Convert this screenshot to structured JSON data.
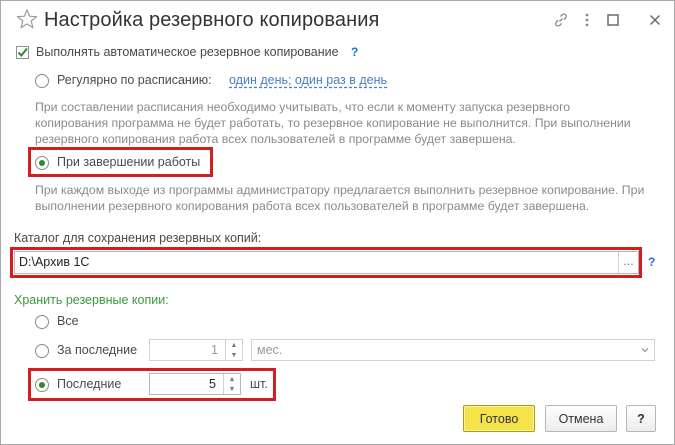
{
  "window": {
    "title": "Настройка резервного копирования"
  },
  "auto_backup": {
    "label": "Выполнять автоматическое резервное копирование",
    "checked": true,
    "help": "?"
  },
  "schedule": {
    "regular_label": "Регулярно по расписанию:",
    "regular_link": "один день; один раз в день",
    "regular_note": "При составлении расписания необходимо учитывать, что если к моменту запуска резервного копирования программа не будет работать, то резервное копирование не выполнится. При выполнении резервного копирования работа всех пользователей в программе будет завершена.",
    "on_exit_label": "При завершении работы",
    "on_exit_note": "При каждом выходе из программы администратору предлагается выполнить резервное копирование. При выполнении резервного копирования работа всех пользователей в программе будет завершена.",
    "selected": "on_exit"
  },
  "directory": {
    "label": "Каталог для сохранения резервных копий:",
    "value": "D:\\Архив 1С",
    "browse": "...",
    "help": "?"
  },
  "retention": {
    "heading": "Хранить резервные копии:",
    "all_label": "Все",
    "period_label": "За последние",
    "period_value": "1",
    "period_unit": "мес.",
    "last_label": "Последние",
    "last_value": "5",
    "last_unit": "шт.",
    "selected": "last"
  },
  "footer": {
    "ok": "Готово",
    "cancel": "Отмена",
    "help": "?"
  },
  "colors": {
    "accent_green": "#3b9a3b",
    "highlight_red": "#d11f1f",
    "primary_button": "#f5e34c",
    "link_blue": "#4a7dc4"
  }
}
